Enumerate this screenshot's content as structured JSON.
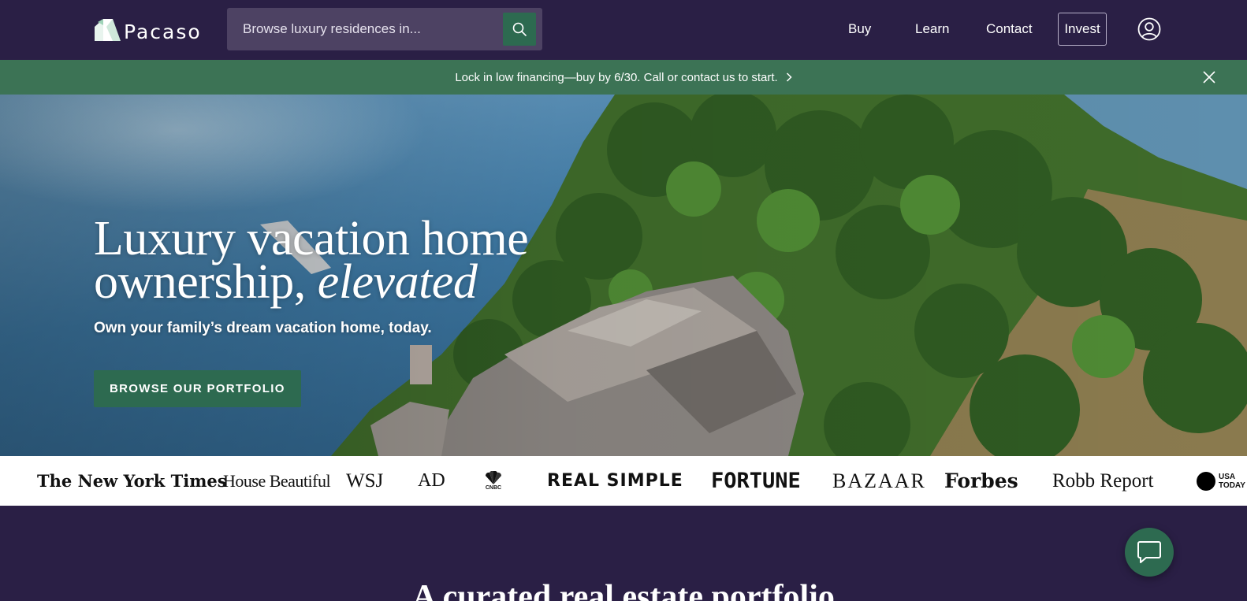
{
  "header": {
    "logo_text": "Pacaso",
    "search": {
      "placeholder": "Browse luxury residences in..."
    },
    "nav": {
      "buy": "Buy",
      "learn": "Learn",
      "contact": "Contact",
      "invest": "Invest"
    }
  },
  "banner": {
    "text": "Lock in low financing—buy by 6/30. Call or contact us to start."
  },
  "hero": {
    "title_line1": "Luxury vacation home",
    "title_line2_plain": "ownership,",
    "title_line2_italic": "elevated",
    "subtitle": "Own your family’s dream vacation home, today.",
    "cta": "BROWSE OUR PORTFOLIO"
  },
  "press": {
    "logos": {
      "nyt": "The New York Times",
      "house_beautiful": "House Beautiful",
      "wsj": "WSJ",
      "ad": "AD",
      "cnbc": "CNBC",
      "real_simple": "REAL SIMPLE",
      "fortune": "FORTUNE",
      "bazaar": "BAZAAR",
      "forbes": "Forbes",
      "robb_report": "Robb Report",
      "usa_today": "USA TODAY"
    }
  },
  "section": {
    "title": "A curated real estate portfolio"
  },
  "colors": {
    "brand_purple": "#2a1f45",
    "brand_green": "#2d6a50",
    "banner_green": "#3c7355",
    "search_bg": "#4d4263"
  }
}
